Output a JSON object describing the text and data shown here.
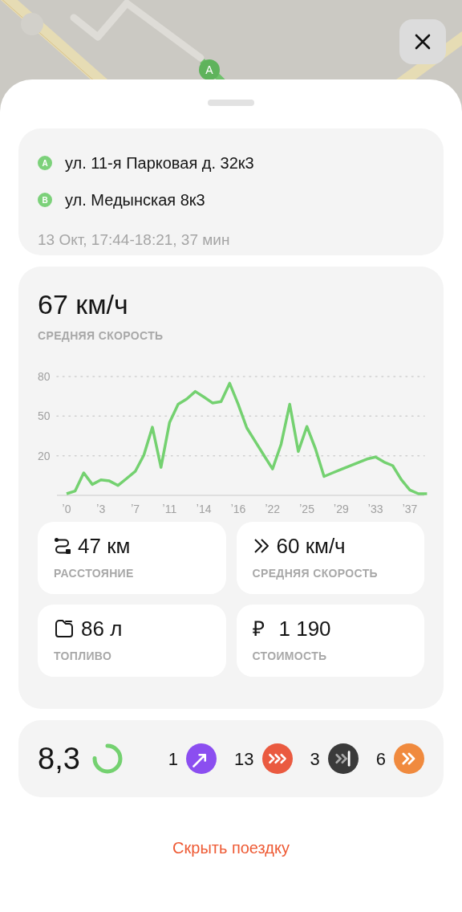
{
  "map": {
    "start_marker": "A"
  },
  "addresses": [
    {
      "marker": "A",
      "text": "ул. 11-я Парковая д. 32к3"
    },
    {
      "marker": "B",
      "text": "ул. Медынская 8к3"
    }
  ],
  "trip_time": "13 Окт, 17:44-18:21, 37 мин",
  "speed_summary": {
    "value": "67 км/ч",
    "label": "СРЕДНЯЯ СКОРОСТЬ"
  },
  "chart_data": {
    "type": "line",
    "grid": true,
    "ylim": [
      -10,
      80
    ],
    "categories": [
      "ʼ0",
      null,
      null,
      null,
      "ʼ3",
      null,
      null,
      null,
      "ʼ7",
      null,
      null,
      null,
      "ʼ11",
      null,
      null,
      null,
      "ʼ14",
      null,
      null,
      null,
      "ʼ16",
      null,
      null,
      null,
      "ʼ22",
      null,
      null,
      null,
      "ʼ25",
      null,
      null,
      null,
      "ʼ29",
      null,
      null,
      null,
      "ʼ33",
      null,
      null,
      null,
      "ʼ37",
      null,
      null
    ],
    "yticks": [
      20,
      50,
      80
    ],
    "series": [
      {
        "color": "#74d170",
        "values": [
          -8.8,
          -6.7,
          7,
          -1.7,
          1.7,
          0.9,
          -2.5,
          2.8,
          8.1,
          20.4,
          41.6,
          11.2,
          45.2,
          59,
          63,
          68.7,
          64.5,
          60,
          61,
          74.9,
          58.9,
          41.1,
          30.7,
          20.3,
          10,
          28.8,
          59,
          23.2,
          42.2,
          25.3,
          4.3,
          7,
          9.7,
          12.3,
          14.9,
          17.5,
          19,
          15.2,
          12.5,
          2,
          -6,
          -8.8,
          -8.8
        ]
      }
    ]
  },
  "metrics": [
    {
      "kind": "route",
      "value": "47 км",
      "label": "РАССТОЯНИЕ"
    },
    {
      "kind": "speed",
      "value": "60 км/ч",
      "label": "СРЕДНЯЯ СКОРОСТЬ"
    },
    {
      "kind": "fuel",
      "value": "86 л",
      "label": "ТОПЛИВО"
    },
    {
      "kind": "currency",
      "symbol": "₽",
      "value": "1 190",
      "label": "СТОИМОСТЬ"
    }
  ],
  "score": {
    "value": "8,3",
    "level": 0.75
  },
  "events": [
    {
      "count": "1",
      "kind": "turn",
      "color": "#8b4ef0"
    },
    {
      "count": "13",
      "kind": "triple",
      "color": "#ea5a40"
    },
    {
      "count": "3",
      "kind": "stop",
      "color": "#3a3a3a"
    },
    {
      "count": "6",
      "kind": "double",
      "color": "#f08a3e"
    }
  ],
  "hide_link": "Скрыть поездку"
}
